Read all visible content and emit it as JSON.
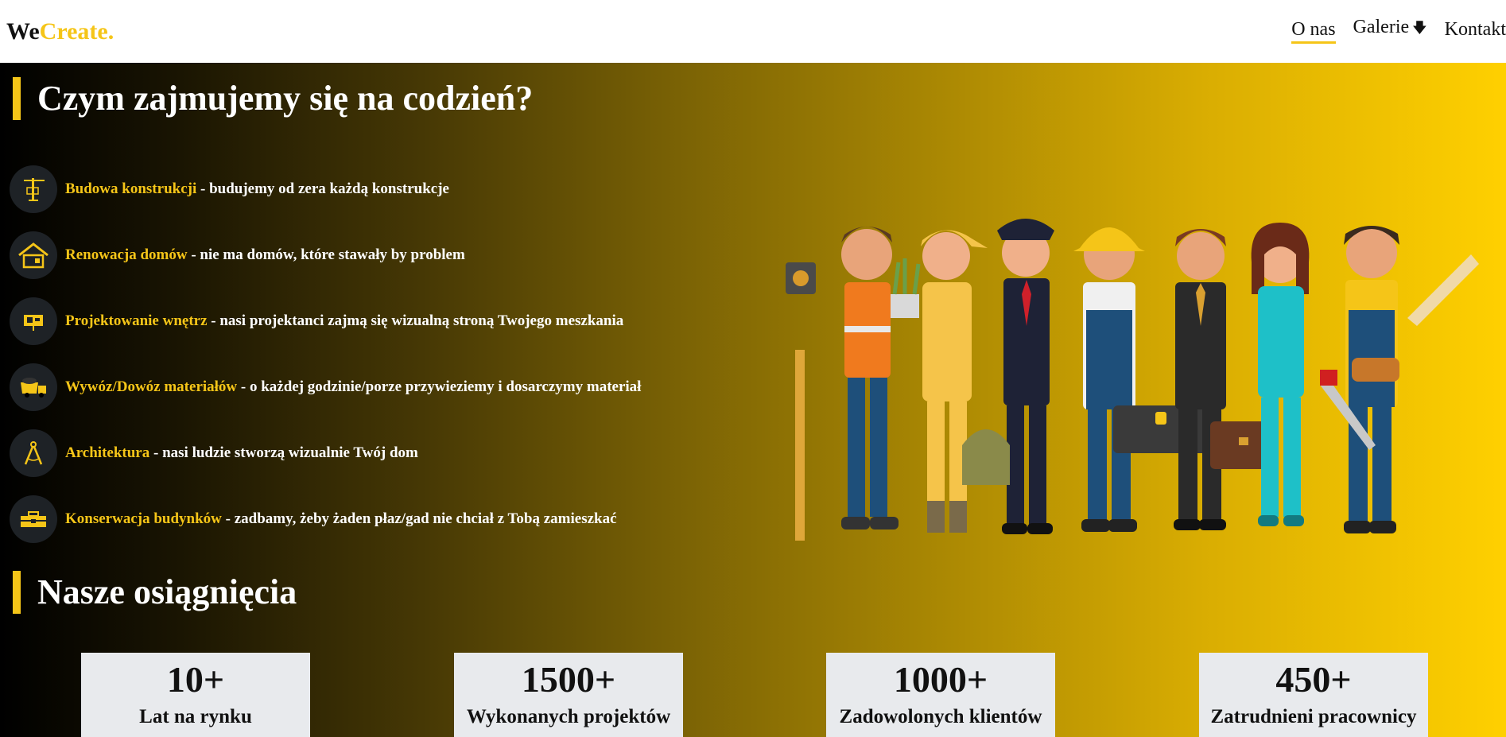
{
  "brand": {
    "part1": "We",
    "part2": "Create."
  },
  "nav": {
    "about": "O nas",
    "gallery": "Galerie",
    "contact": "Kontakt"
  },
  "section1": {
    "title": "Czym zajmujemy się na codzień?"
  },
  "services": [
    {
      "name": "Budowa konstrukcji",
      "desc": " - budujemy od zera każdą konstrukcje",
      "icon": "crane-icon"
    },
    {
      "name": "Renowacja domów",
      "desc": " - nie ma domów, które stawały by problem",
      "icon": "house-icon"
    },
    {
      "name": "Projektowanie wnętrz",
      "desc": " - nasi projektanci zajmą się wizualną stroną Twojego meszkania",
      "icon": "blueprint-icon"
    },
    {
      "name": "Wywóz/Dowóz materiałów",
      "desc": " - o każdej godzinie/porze przywieziemy i dosarczymy materiał",
      "icon": "truck-icon"
    },
    {
      "name": "Architektura",
      "desc": " - nasi ludzie stworzą wizualnie Twój dom",
      "icon": "compass-icon"
    },
    {
      "name": "Konserwacja budynków",
      "desc": " - zadbamy, żeby żaden płaz/gad nie chciał z Tobą zamieszkać",
      "icon": "toolbox-icon"
    }
  ],
  "section2": {
    "title": "Nasze osiągnięcia"
  },
  "stats": [
    {
      "value": "10+",
      "label": "Lat na rynku"
    },
    {
      "value": "1500+",
      "label": "Wykonanych projektów"
    },
    {
      "value": "1000+",
      "label": "Zadowolonych klientów"
    },
    {
      "value": "450+",
      "label": "Zatrudnieni pracownicy"
    }
  ],
  "colors": {
    "accent": "#f5c518",
    "icon_bg": "#1e2226",
    "stat_bg": "#e8eaed"
  }
}
